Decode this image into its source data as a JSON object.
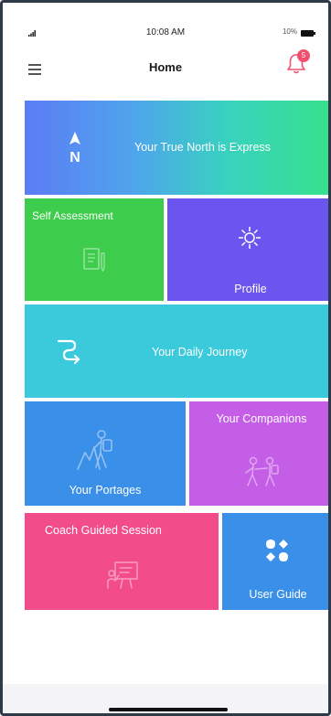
{
  "status_bar": {
    "time": "10:08 AM",
    "battery_text": "10%"
  },
  "header": {
    "title": "Home",
    "notification_count": "5"
  },
  "tiles": {
    "true_north": {
      "label": "Your True North is Express",
      "icon": "north-compass-icon"
    },
    "self_assessment": {
      "label": "Self Assessment",
      "icon": "assessment-document-icon"
    },
    "profile": {
      "label": "Profile",
      "icon": "sun-burst-icon"
    },
    "daily_journey": {
      "label": "Your Daily Journey",
      "icon": "route-arrow-icon"
    },
    "portages": {
      "label": "Your Portages",
      "icon": "hiker-icon"
    },
    "companions": {
      "label": "Your Companions",
      "icon": "companions-hikers-icon"
    },
    "coach": {
      "label": "Coach Guided Session",
      "icon": "coach-board-icon"
    },
    "user_guide": {
      "label": "User Guide",
      "icon": "guide-grid-icon"
    }
  },
  "colors": {
    "self_assessment": "#3dcc4b",
    "profile": "#6a55ee",
    "daily_journey": "#3bc9dc",
    "portages": "#3a8fe8",
    "companions": "#c55ee6",
    "coach": "#f24d8a",
    "user_guide": "#3a8fe8",
    "badge": "#f0506e"
  }
}
